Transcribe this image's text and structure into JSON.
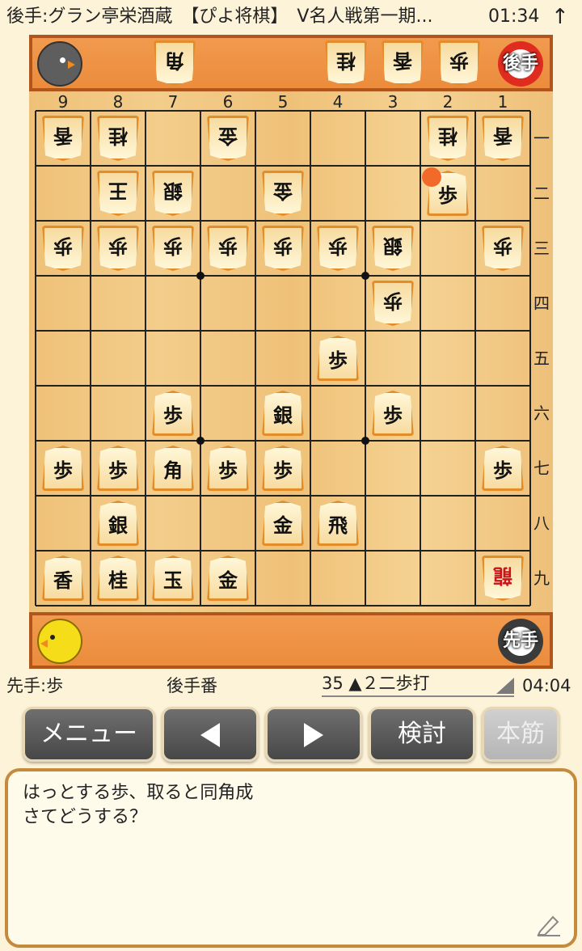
{
  "status_bar": {
    "title": "後手:グラン亭栄酒蔵　【ぴよ将棋】　V名人戦第一期...",
    "time": "01:34",
    "arrow": "↑"
  },
  "gote_tray": {
    "badge": "後手",
    "pieces": [
      "角",
      "桂",
      "香",
      "歩"
    ]
  },
  "sente_tray": {
    "badge": "先手"
  },
  "board": {
    "file_labels": [
      "9",
      "8",
      "7",
      "6",
      "5",
      "4",
      "3",
      "2",
      "1"
    ],
    "rank_labels": [
      "一",
      "二",
      "三",
      "四",
      "五",
      "六",
      "七",
      "八",
      "九"
    ],
    "pieces": [
      {
        "file": 9,
        "rank": 1,
        "label": "香",
        "owner": "gote"
      },
      {
        "file": 8,
        "rank": 1,
        "label": "桂",
        "owner": "gote"
      },
      {
        "file": 6,
        "rank": 1,
        "label": "金",
        "owner": "gote"
      },
      {
        "file": 2,
        "rank": 1,
        "label": "桂",
        "owner": "gote"
      },
      {
        "file": 1,
        "rank": 1,
        "label": "香",
        "owner": "gote"
      },
      {
        "file": 8,
        "rank": 2,
        "label": "王",
        "owner": "gote"
      },
      {
        "file": 7,
        "rank": 2,
        "label": "銀",
        "owner": "gote"
      },
      {
        "file": 5,
        "rank": 2,
        "label": "金",
        "owner": "gote"
      },
      {
        "file": 2,
        "rank": 2,
        "label": "歩",
        "owner": "sente"
      },
      {
        "file": 9,
        "rank": 3,
        "label": "歩",
        "owner": "gote"
      },
      {
        "file": 8,
        "rank": 3,
        "label": "歩",
        "owner": "gote"
      },
      {
        "file": 7,
        "rank": 3,
        "label": "歩",
        "owner": "gote"
      },
      {
        "file": 6,
        "rank": 3,
        "label": "歩",
        "owner": "gote"
      },
      {
        "file": 5,
        "rank": 3,
        "label": "歩",
        "owner": "gote"
      },
      {
        "file": 4,
        "rank": 3,
        "label": "歩",
        "owner": "gote"
      },
      {
        "file": 3,
        "rank": 3,
        "label": "銀",
        "owner": "gote"
      },
      {
        "file": 1,
        "rank": 3,
        "label": "歩",
        "owner": "gote"
      },
      {
        "file": 3,
        "rank": 4,
        "label": "歩",
        "owner": "gote"
      },
      {
        "file": 4,
        "rank": 5,
        "label": "歩",
        "owner": "sente"
      },
      {
        "file": 7,
        "rank": 6,
        "label": "歩",
        "owner": "sente"
      },
      {
        "file": 5,
        "rank": 6,
        "label": "銀",
        "owner": "sente"
      },
      {
        "file": 3,
        "rank": 6,
        "label": "歩",
        "owner": "sente"
      },
      {
        "file": 9,
        "rank": 7,
        "label": "歩",
        "owner": "sente"
      },
      {
        "file": 8,
        "rank": 7,
        "label": "歩",
        "owner": "sente"
      },
      {
        "file": 7,
        "rank": 7,
        "label": "角",
        "owner": "sente"
      },
      {
        "file": 6,
        "rank": 7,
        "label": "歩",
        "owner": "sente"
      },
      {
        "file": 5,
        "rank": 7,
        "label": "歩",
        "owner": "sente"
      },
      {
        "file": 1,
        "rank": 7,
        "label": "歩",
        "owner": "sente"
      },
      {
        "file": 8,
        "rank": 8,
        "label": "銀",
        "owner": "sente"
      },
      {
        "file": 5,
        "rank": 8,
        "label": "金",
        "owner": "sente"
      },
      {
        "file": 4,
        "rank": 8,
        "label": "飛",
        "owner": "sente"
      },
      {
        "file": 9,
        "rank": 9,
        "label": "香",
        "owner": "sente"
      },
      {
        "file": 8,
        "rank": 9,
        "label": "桂",
        "owner": "sente"
      },
      {
        "file": 7,
        "rank": 9,
        "label": "玉",
        "owner": "sente"
      },
      {
        "file": 6,
        "rank": 9,
        "label": "金",
        "owner": "sente"
      },
      {
        "file": 1,
        "rank": 9,
        "label": "龍",
        "owner": "gote",
        "promoted": true
      }
    ],
    "last_move": {
      "file": 2,
      "rank": 2
    }
  },
  "info": {
    "sente_hand": "先手:歩",
    "turn": "後手番",
    "move": "35 ▲２二歩打",
    "clock": "04:04"
  },
  "buttons": {
    "menu": "メニュー",
    "review": "検討",
    "honsuji": "本筋"
  },
  "comment": {
    "line1": "はっとする歩、取ると同角成",
    "line2": "さてどうする？"
  },
  "colors": {
    "tray": "#ec8c3c",
    "board": "#f3cd8b",
    "button": "#555555",
    "marker": "#f26a2a"
  }
}
